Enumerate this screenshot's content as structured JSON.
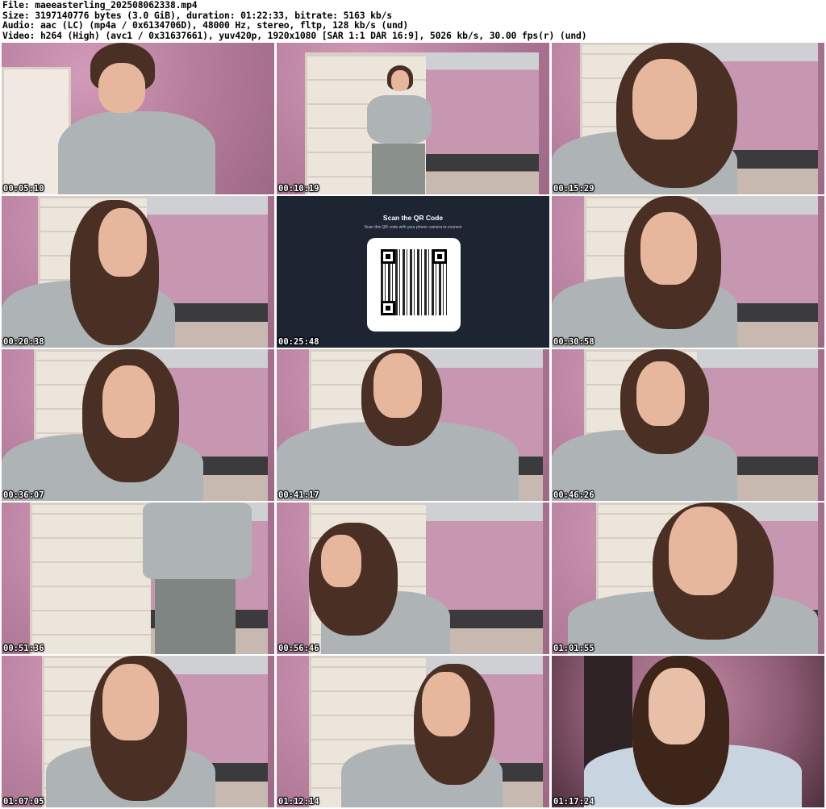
{
  "header": {
    "line1": "File: maeeasterling_202508062338.mp4",
    "line2": "Size: 3197140776 bytes (3.0 GiB), duration: 01:22:33, bitrate: 5163 kb/s",
    "line3": "Audio: aac (LC) (mp4a / 0x6134706D), 48000 Hz, stereo, fltp, 128 kb/s (und)",
    "line4": "Video: h264 (High) (avc1 / 0x31637661), yuv420p, 1920x1080 [SAR 1:1 DAR 16:9], 5026 kb/s, 30.00 fps(r) (und)"
  },
  "qr": {
    "title": "Scan the QR Code",
    "subtitle": "Scan this QR code with your phone camera to connect"
  },
  "thumbnails": [
    {
      "time": "00:05:10"
    },
    {
      "time": "00:10:19"
    },
    {
      "time": "00:15:29"
    },
    {
      "time": "00:20:38"
    },
    {
      "time": "00:25:48"
    },
    {
      "time": "00:30:58"
    },
    {
      "time": "00:36:07"
    },
    {
      "time": "00:41:17"
    },
    {
      "time": "00:46:26"
    },
    {
      "time": "00:51:36"
    },
    {
      "time": "00:56:46"
    },
    {
      "time": "01:01:55"
    },
    {
      "time": "01:07:05"
    },
    {
      "time": "01:12:14"
    },
    {
      "time": "01:17:24"
    }
  ]
}
